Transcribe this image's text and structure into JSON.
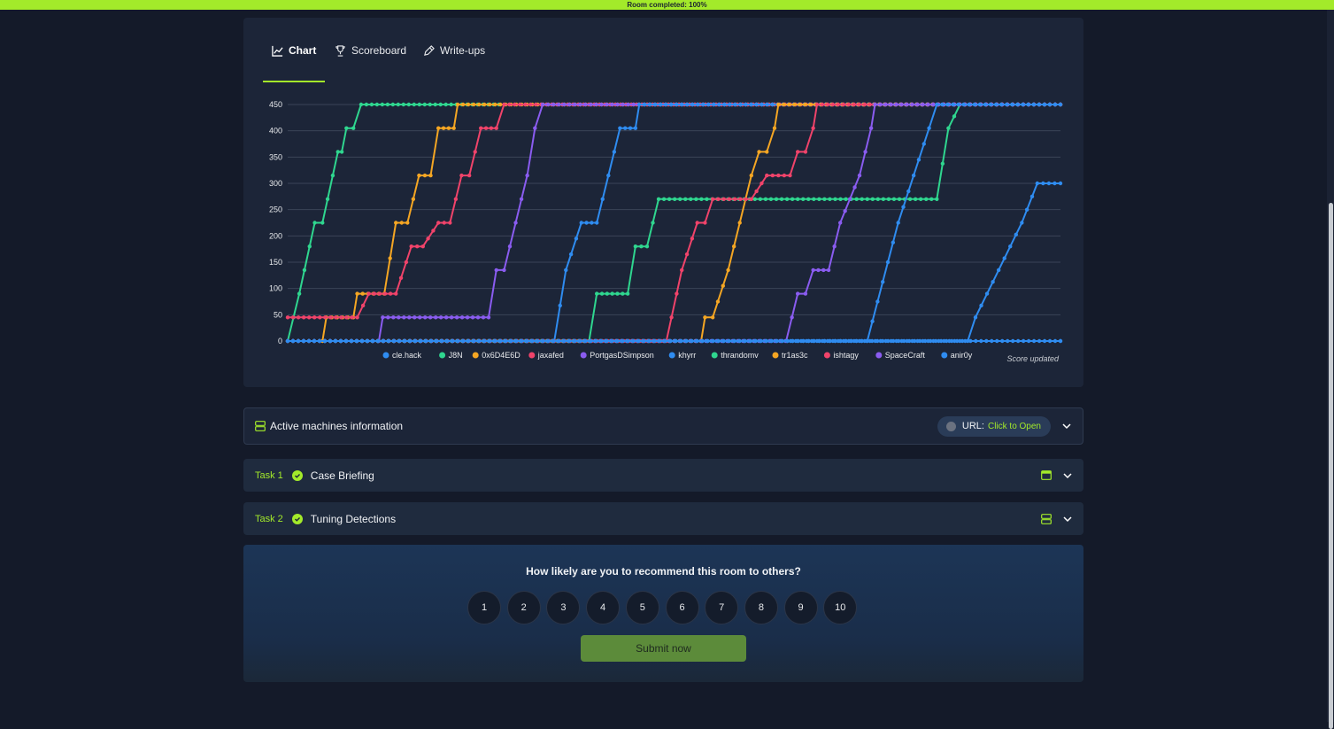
{
  "topbar": {
    "label": "Room completed: 100%"
  },
  "tabs": [
    {
      "label": "Chart",
      "icon": "chart-line-icon"
    },
    {
      "label": "Scoreboard",
      "icon": "trophy-icon"
    },
    {
      "label": "Write-ups",
      "icon": "pen-icon"
    }
  ],
  "chart_data": {
    "type": "line",
    "ylim": [
      0,
      450
    ],
    "yticks": [
      0,
      50,
      100,
      150,
      200,
      250,
      300,
      350,
      400,
      450
    ],
    "note": "Score updated",
    "legend_position": "bottom",
    "series": [
      {
        "name": "cle.hack",
        "color": "#2f8cf0",
        "points": [
          [
            0,
            0
          ],
          [
            100,
            0
          ],
          [
            100,
            0
          ]
        ]
      },
      {
        "name": "J8N",
        "color": "#2fd68f",
        "points": [
          [
            0,
            0
          ],
          [
            1.5,
            90
          ],
          [
            3.5,
            225
          ],
          [
            4.5,
            225
          ],
          [
            6.5,
            360
          ],
          [
            7,
            360
          ],
          [
            7.6,
            405
          ],
          [
            8.5,
            405
          ],
          [
            9.5,
            450
          ],
          [
            100,
            450
          ]
        ]
      },
      {
        "name": "0x6D4E6D",
        "color": "#f5a623",
        "points": [
          [
            4.5,
            0
          ],
          [
            5,
            45
          ],
          [
            8.5,
            45
          ],
          [
            9,
            90
          ],
          [
            12.5,
            90
          ],
          [
            14,
            225
          ],
          [
            15.5,
            225
          ],
          [
            17,
            315
          ],
          [
            18.5,
            315
          ],
          [
            19.5,
            405
          ],
          [
            21.5,
            405
          ],
          [
            22,
            450
          ],
          [
            100,
            450
          ]
        ]
      },
      {
        "name": "jaxafed",
        "color": "#f0436a",
        "points": [
          [
            0,
            45
          ],
          [
            9,
            45
          ],
          [
            10.5,
            90
          ],
          [
            14,
            90
          ],
          [
            16,
            180
          ],
          [
            17.5,
            180
          ],
          [
            19.5,
            225
          ],
          [
            21,
            225
          ],
          [
            22.5,
            315
          ],
          [
            23.5,
            315
          ],
          [
            25,
            405
          ],
          [
            27,
            405
          ],
          [
            28,
            450
          ],
          [
            100,
            450
          ]
        ]
      },
      {
        "name": "PortgasDSimpson",
        "color": "#8a5cf0",
        "points": [
          [
            11.8,
            0
          ],
          [
            12.3,
            45
          ],
          [
            26,
            45
          ],
          [
            27,
            135
          ],
          [
            28,
            135
          ],
          [
            31,
            315
          ],
          [
            32,
            405
          ],
          [
            33,
            450
          ],
          [
            100,
            450
          ]
        ]
      },
      {
        "name": "khyrr",
        "color": "#2f8cf0",
        "points": [
          [
            0,
            0
          ],
          [
            34.5,
            0
          ],
          [
            36,
            135
          ],
          [
            38,
            225
          ],
          [
            40,
            225
          ],
          [
            43,
            405
          ],
          [
            45,
            405
          ],
          [
            45.5,
            450
          ],
          [
            100,
            450
          ]
        ]
      },
      {
        "name": "thrandomv",
        "color": "#2fd68f",
        "points": [
          [
            0,
            0
          ],
          [
            39,
            0
          ],
          [
            40,
            90
          ],
          [
            44,
            90
          ],
          [
            45,
            180
          ],
          [
            46.5,
            180
          ],
          [
            48,
            270
          ],
          [
            84,
            270
          ],
          [
            85.5,
            405
          ],
          [
            87,
            450
          ],
          [
            100,
            450
          ]
        ]
      },
      {
        "name": "tr1as3c",
        "color": "#f5a623",
        "points": [
          [
            0,
            0
          ],
          [
            53.5,
            0
          ],
          [
            54,
            45
          ],
          [
            55,
            45
          ],
          [
            57,
            135
          ],
          [
            60,
            315
          ],
          [
            61,
            360
          ],
          [
            62,
            360
          ],
          [
            63,
            405
          ],
          [
            63.5,
            450
          ],
          [
            100,
            450
          ]
        ]
      },
      {
        "name": "ishtagy",
        "color": "#f0436a",
        "points": [
          [
            0,
            0
          ],
          [
            49,
            0
          ],
          [
            51,
            135
          ],
          [
            53,
            225
          ],
          [
            54,
            225
          ],
          [
            55,
            270
          ],
          [
            60,
            270
          ],
          [
            62,
            315
          ],
          [
            65,
            315
          ],
          [
            66,
            360
          ],
          [
            67,
            360
          ],
          [
            68,
            405
          ],
          [
            68.5,
            450
          ],
          [
            100,
            450
          ]
        ]
      },
      {
        "name": "SpaceCraft",
        "color": "#8a5cf0",
        "points": [
          [
            0,
            0
          ],
          [
            64.5,
            0
          ],
          [
            66,
            90
          ],
          [
            67,
            90
          ],
          [
            68,
            135
          ],
          [
            70,
            135
          ],
          [
            71.5,
            225
          ],
          [
            74,
            315
          ],
          [
            75.5,
            405
          ],
          [
            76,
            450
          ],
          [
            100,
            450
          ]
        ]
      },
      {
        "name": "anir0y",
        "color": "#2f8cf0",
        "points": [
          [
            0,
            0
          ],
          [
            75,
            0
          ],
          [
            79,
            225
          ],
          [
            83,
            405
          ],
          [
            84,
            450
          ],
          [
            100,
            450
          ]
        ]
      },
      {
        "name": "",
        "color": "#2f8cf0",
        "points": [
          [
            0,
            0
          ],
          [
            88,
            0
          ],
          [
            89,
            45
          ],
          [
            92,
            135
          ],
          [
            95,
            225
          ],
          [
            97,
            300
          ],
          [
            100,
            300
          ]
        ]
      }
    ]
  },
  "machines": {
    "label": "Active machines information",
    "url_label": "URL:",
    "url_link": "Click to Open"
  },
  "tasks": [
    {
      "num": "Task 1",
      "title": "Case Briefing"
    },
    {
      "num": "Task 2",
      "title": "Tuning Detections"
    }
  ],
  "feedback": {
    "question": "How likely are you to recommend this room to others?",
    "options": [
      "1",
      "2",
      "3",
      "4",
      "5",
      "6",
      "7",
      "8",
      "9",
      "10"
    ],
    "submit_label": "Submit now"
  }
}
